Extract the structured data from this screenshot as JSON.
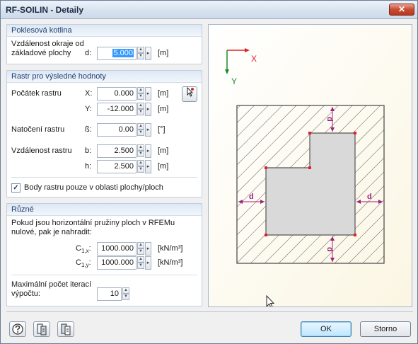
{
  "window": {
    "title": "RF-SOILIN - Detaily",
    "close_label": "✕"
  },
  "g1": {
    "header": "Poklesová kotlina",
    "label_line1": "Vzdálenost okraje od",
    "label_line2": "základové plochy",
    "var": "d:",
    "value": "5.000",
    "unit": "[m]"
  },
  "g2": {
    "header": "Rastr pro výsledné hodnoty",
    "origin_label": "Počátek rastru",
    "x_var": "X:",
    "x_value": "0.000",
    "x_unit": "[m]",
    "y_var": "Y:",
    "y_value": "-12.000",
    "y_unit": "[m]",
    "rot_label": "Natočení rastru",
    "rot_var": "ß:",
    "rot_value": "0.00",
    "rot_unit": "[°]",
    "dist_label": "Vzdálenost rastru",
    "b_var": "b:",
    "b_value": "2.500",
    "b_unit": "[m]",
    "h_var": "h:",
    "h_value": "2.500",
    "h_unit": "[m]",
    "checkbox_label": "Body rastru pouze v oblasti plochy/ploch",
    "checkbox_checked": true
  },
  "g3": {
    "header": "Různé",
    "text1": "Pokud jsou horizontální pružiny ploch v RFEMu",
    "text2": "nulové, pak je nahradit:",
    "c1x_base": "C",
    "c1x_sub": "1,x",
    "c1x_colon": ":",
    "c1x_value": "1000.000",
    "c1x_unit": "[kN/m³]",
    "c1y_base": "C",
    "c1y_sub": "1,y",
    "c1y_colon": ":",
    "c1y_value": "1000.000",
    "c1y_unit": "[kN/m³]",
    "iter_label1": "Maximální počet iterací",
    "iter_label2": "výpočtu:",
    "iter_value": "10"
  },
  "preview": {
    "axis_x": "X",
    "axis_y": "Y",
    "dim": "d"
  },
  "buttons": {
    "ok": "OK",
    "cancel": "Storno"
  },
  "colors": {
    "accent_red": "#e0222a",
    "axis_green": "#1a8a2a",
    "dim_magenta": "#a0207a"
  }
}
